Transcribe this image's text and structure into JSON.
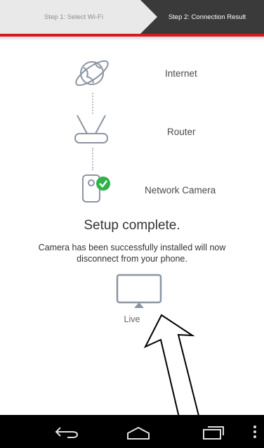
{
  "steps": {
    "step1_label": "Step 1: Select Wi-Fi",
    "step2_label": "Step 2: Connection Result"
  },
  "diagram": {
    "items": [
      {
        "label": "Internet",
        "icon": "globe-icon"
      },
      {
        "label": "Router",
        "icon": "router-icon"
      },
      {
        "label": "Network Camera",
        "icon": "camera-icon"
      }
    ],
    "status_icon": "checkmark-icon"
  },
  "result": {
    "title": "Setup complete.",
    "description": "Camera has been successfully installed will now disconnect from your phone."
  },
  "live": {
    "label": "Live",
    "icon": "monitor-icon"
  },
  "annotation": {
    "icon": "arrow-pointer-icon"
  },
  "navbar": {
    "back": "back-icon",
    "home": "home-icon",
    "recents": "recents-icon",
    "menu": "menu-icon"
  },
  "colors": {
    "accent_red": "#d7191f",
    "step_active": "#3a3a3a",
    "step_inactive": "#e9e9e9",
    "success_green": "#2fb24a"
  }
}
